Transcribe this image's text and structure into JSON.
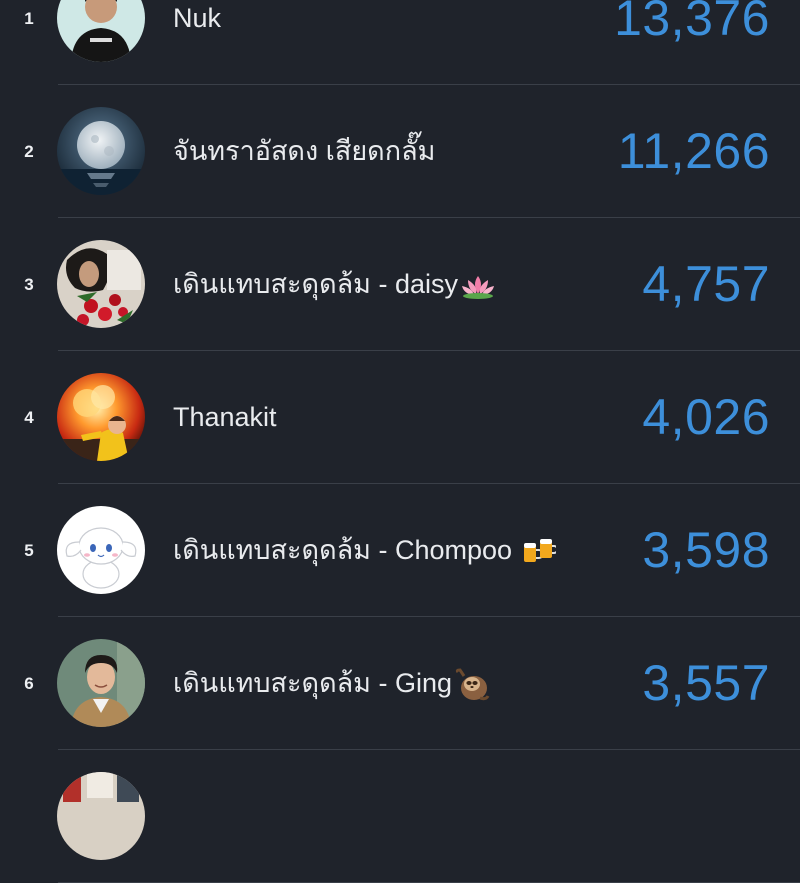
{
  "leaderboard": {
    "entries": [
      {
        "rank": "1",
        "name": "Nuk",
        "score": "13,376",
        "avatar_icon": "person-black-shirt-avatar"
      },
      {
        "rank": "2",
        "name": "จันทราอัสดง เสียดกลั๊ม",
        "score": "11,266",
        "avatar_icon": "full-moon-avatar"
      },
      {
        "rank": "3",
        "name": "เดินแทบสะดุดล้ม - daisy",
        "name_emoji": "lotus-icon",
        "score": "4,757",
        "avatar_icon": "person-with-roses-avatar"
      },
      {
        "rank": "4",
        "name": "Thanakit",
        "score": "4,026",
        "avatar_icon": "explosion-kid-avatar"
      },
      {
        "rank": "5",
        "name": "เดินแทบสะดุดล้ม - Chompoo",
        "name_emoji": "beer-mugs-icon",
        "score": "3,598",
        "avatar_icon": "cinnamoroll-avatar"
      },
      {
        "rank": "6",
        "name": "เดินแทบสะดุดล้ม - Ging",
        "name_emoji": "sloth-icon",
        "score": "3,557",
        "avatar_icon": "man-portrait-avatar"
      },
      {
        "rank": "",
        "name": "",
        "score": "",
        "avatar_icon": "partial-avatar"
      }
    ]
  },
  "colors": {
    "background": "#1f232b",
    "score": "#3d8fda",
    "divider": "#3a3f48",
    "text": "#e9ebee"
  }
}
